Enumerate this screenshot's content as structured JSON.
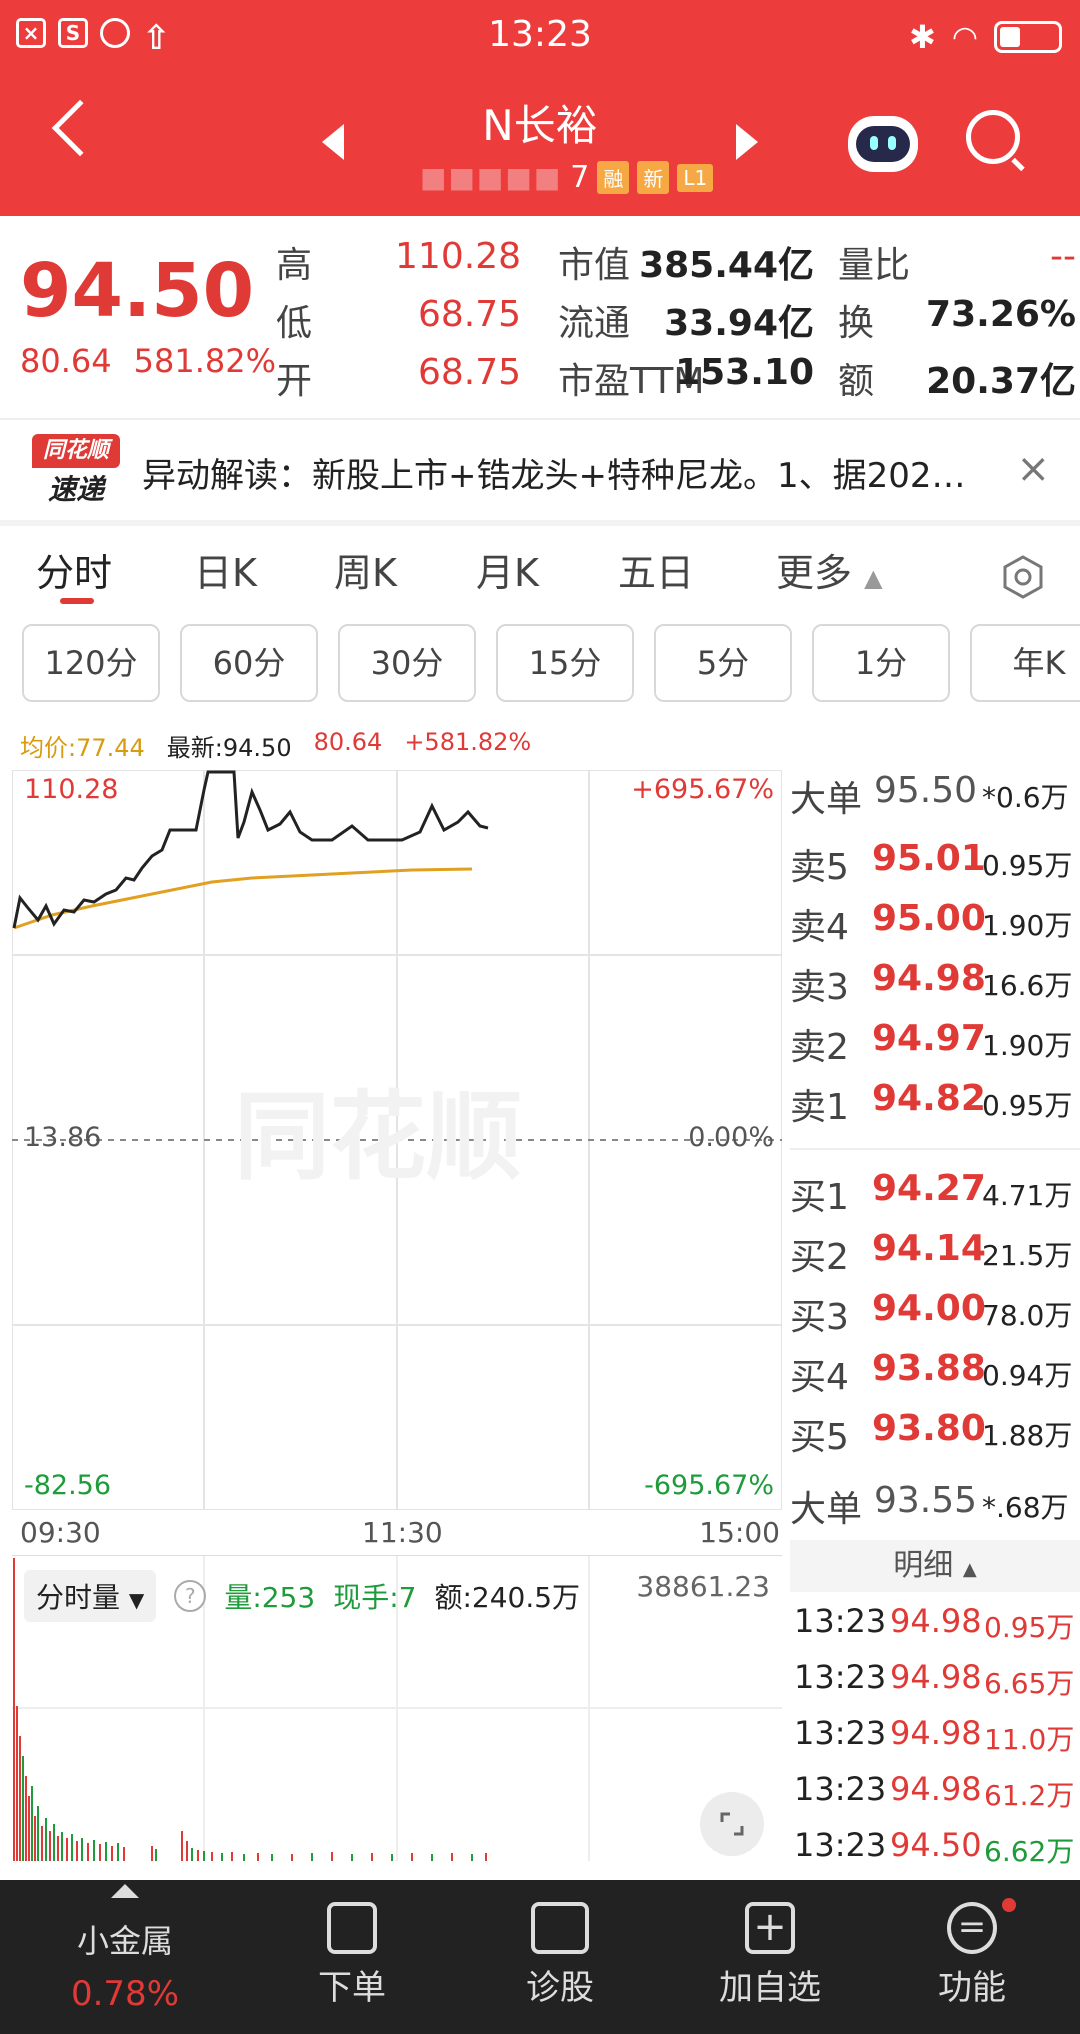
{
  "status": {
    "time": "13:23"
  },
  "header": {
    "name": "N长裕",
    "code_tail": "7",
    "tags": [
      "融",
      "新",
      "L1"
    ]
  },
  "quote": {
    "price": "94.50",
    "change": "80.64",
    "change_pct": "581.82%",
    "rows": [
      {
        "l1": "高",
        "v1": "110.28",
        "l2": "市值",
        "v2": "385.44亿",
        "l3": "量比",
        "v3": "--"
      },
      {
        "l1": "低",
        "v1": "68.75",
        "l2": "流通",
        "v2": "33.94亿",
        "l3": "换",
        "v3": "73.26%"
      },
      {
        "l1": "开",
        "v1": "68.75",
        "l2": "市盈TTM",
        "v2": "153.10",
        "l3": "额",
        "v3": "20.37亿"
      }
    ]
  },
  "news": {
    "logo_top": "同花顺",
    "logo_bottom": "速递",
    "text": "异动解读：新股上市+锆龙头+特种尼龙。1、据202…",
    "close": "×"
  },
  "tabs": [
    "分时",
    "日K",
    "周K",
    "月K",
    "五日",
    "更多"
  ],
  "intervals": [
    "120分",
    "60分",
    "30分",
    "15分",
    "5分",
    "1分",
    "年K"
  ],
  "chart_header": {
    "avg": "均价:77.44",
    "latest": "最新:94.50",
    "change": "80.64",
    "change_pct": "+581.82%"
  },
  "chart_labels": {
    "top_left": "110.28",
    "top_right": "+695.67%",
    "mid_left": "13.86",
    "mid_right": "0.00%",
    "bottom_left": "-82.56",
    "bottom_right": "-695.67%",
    "watermark": "同花顺"
  },
  "time_axis": [
    "09:30",
    "11:30",
    "15:00"
  ],
  "order_book": {
    "big_sell": {
      "label": "大单",
      "price": "95.50",
      "vol": "*0.6万"
    },
    "sells": [
      {
        "label": "卖5",
        "price": "95.01",
        "vol": "0.95万"
      },
      {
        "label": "卖4",
        "price": "95.00",
        "vol": "1.90万"
      },
      {
        "label": "卖3",
        "price": "94.98",
        "vol": "16.6万"
      },
      {
        "label": "卖2",
        "price": "94.97",
        "vol": "1.90万"
      },
      {
        "label": "卖1",
        "price": "94.82",
        "vol": "0.95万"
      }
    ],
    "buys": [
      {
        "label": "买1",
        "price": "94.27",
        "vol": "4.71万"
      },
      {
        "label": "买2",
        "price": "94.14",
        "vol": "21.5万"
      },
      {
        "label": "买3",
        "price": "94.00",
        "vol": "78.0万"
      },
      {
        "label": "买4",
        "price": "93.88",
        "vol": "0.94万"
      },
      {
        "label": "买5",
        "price": "93.80",
        "vol": "1.88万"
      }
    ],
    "big_buy": {
      "label": "大单",
      "price": "93.55",
      "vol": "*.68万"
    }
  },
  "volume": {
    "selector": "分时量",
    "vol": "量:253",
    "hand": "现手:7",
    "amount": "额:240.5万",
    "max": "38861.23"
  },
  "details": {
    "header": "明细",
    "rows": [
      {
        "time": "13:23",
        "price": "94.98",
        "vol": "0.95万",
        "dir": "down"
      },
      {
        "time": "13:23",
        "price": "94.98",
        "vol": "6.65万",
        "dir": "up"
      },
      {
        "time": "13:23",
        "price": "94.98",
        "vol": "11.0万",
        "dir": "up"
      },
      {
        "time": "13:23",
        "price": "94.98",
        "vol": "61.2万",
        "dir": "up"
      },
      {
        "time": "13:23",
        "price": "94.50",
        "vol": "6.62万",
        "dir": "down"
      }
    ]
  },
  "bottom_bar": {
    "metal_label": "小金属",
    "metal_pct": "0.78%",
    "items": [
      "下单",
      "诊股",
      "加自选",
      "功能"
    ]
  },
  "colors": {
    "header": "#ec3c3c",
    "up": "#e03a37",
    "down": "#1e9b3a",
    "avg_line": "#e0a020"
  }
}
